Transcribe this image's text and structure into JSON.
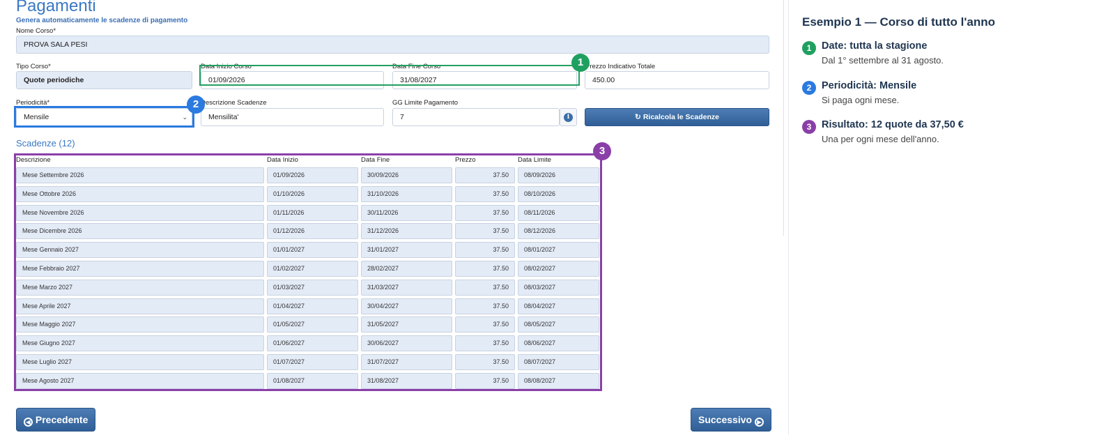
{
  "page": {
    "title": "Pagamenti",
    "subtitle": "Genera automaticamente le scadenze di pagamento"
  },
  "form": {
    "nome_corso": {
      "label": "Nome Corso*",
      "value": "PROVA SALA PESI"
    },
    "tipo_corso": {
      "label": "Tipo Corso*",
      "value": "Quote periodiche"
    },
    "data_inizio": {
      "label": "Data Inizio Corso",
      "value": "01/09/2026"
    },
    "data_fine": {
      "label": "Data Fine Corso",
      "value": "31/08/2027"
    },
    "prezzo": {
      "label": "Prezzo Indicativo Totale",
      "value": "450.00"
    },
    "periodicita": {
      "label": "Periodicità*",
      "value": "Mensile"
    },
    "descrizione": {
      "label": "Descrizione Scadenze",
      "value": "Mensilita'"
    },
    "gg_limite": {
      "label": "GG Limite Pagamento",
      "value": "7"
    },
    "recalc_button": "Ricalcola le Scadenze"
  },
  "scadenze": {
    "title": "Scadenze (12)",
    "columns": [
      "Descrizione",
      "Data Inizio",
      "Data Fine",
      "Prezzo",
      "Data Limite"
    ],
    "rows": [
      [
        "Mese Settembre 2026",
        "01/09/2026",
        "30/09/2026",
        "37.50",
        "08/09/2026"
      ],
      [
        "Mese Ottobre 2026",
        "01/10/2026",
        "31/10/2026",
        "37.50",
        "08/10/2026"
      ],
      [
        "Mese Novembre 2026",
        "01/11/2026",
        "30/11/2026",
        "37.50",
        "08/11/2026"
      ],
      [
        "Mese Dicembre 2026",
        "01/12/2026",
        "31/12/2026",
        "37.50",
        "08/12/2026"
      ],
      [
        "Mese Gennaio 2027",
        "01/01/2027",
        "31/01/2027",
        "37.50",
        "08/01/2027"
      ],
      [
        "Mese Febbraio 2027",
        "01/02/2027",
        "28/02/2027",
        "37.50",
        "08/02/2027"
      ],
      [
        "Mese Marzo 2027",
        "01/03/2027",
        "31/03/2027",
        "37.50",
        "08/03/2027"
      ],
      [
        "Mese Aprile 2027",
        "01/04/2027",
        "30/04/2027",
        "37.50",
        "08/04/2027"
      ],
      [
        "Mese Maggio 2027",
        "01/05/2027",
        "31/05/2027",
        "37.50",
        "08/05/2027"
      ],
      [
        "Mese Giugno 2027",
        "01/06/2027",
        "30/06/2027",
        "37.50",
        "08/06/2027"
      ],
      [
        "Mese Luglio 2027",
        "01/07/2027",
        "31/07/2027",
        "37.50",
        "08/07/2027"
      ],
      [
        "Mese Agosto 2027",
        "01/08/2027",
        "31/08/2027",
        "37.50",
        "08/08/2027"
      ]
    ]
  },
  "nav": {
    "prev": "Precedente",
    "next": "Successivo"
  },
  "badges": [
    "1",
    "2",
    "3"
  ],
  "sidebar": {
    "title": "Esempio 1 — Corso di tutto l'anno",
    "items": [
      {
        "num": "1",
        "head": "Date: tutta la stagione",
        "text": "Dal 1° settembre al 31 agosto.",
        "color": "#20a060"
      },
      {
        "num": "2",
        "head": "Periodicità: Mensile",
        "text": "Si paga ogni mese.",
        "color": "#2a7ae0"
      },
      {
        "num": "3",
        "head": "Risultato: 12 quote da 37,50 €",
        "text": "Una per ogni mese dell'anno.",
        "color": "#8a3fa8"
      }
    ]
  },
  "colors": {
    "accent": "#3a78c4",
    "button": "#3a6aa0",
    "highlight_green": "#20a060",
    "highlight_blue": "#2a7ae0",
    "highlight_purple": "#8a3fa8"
  }
}
